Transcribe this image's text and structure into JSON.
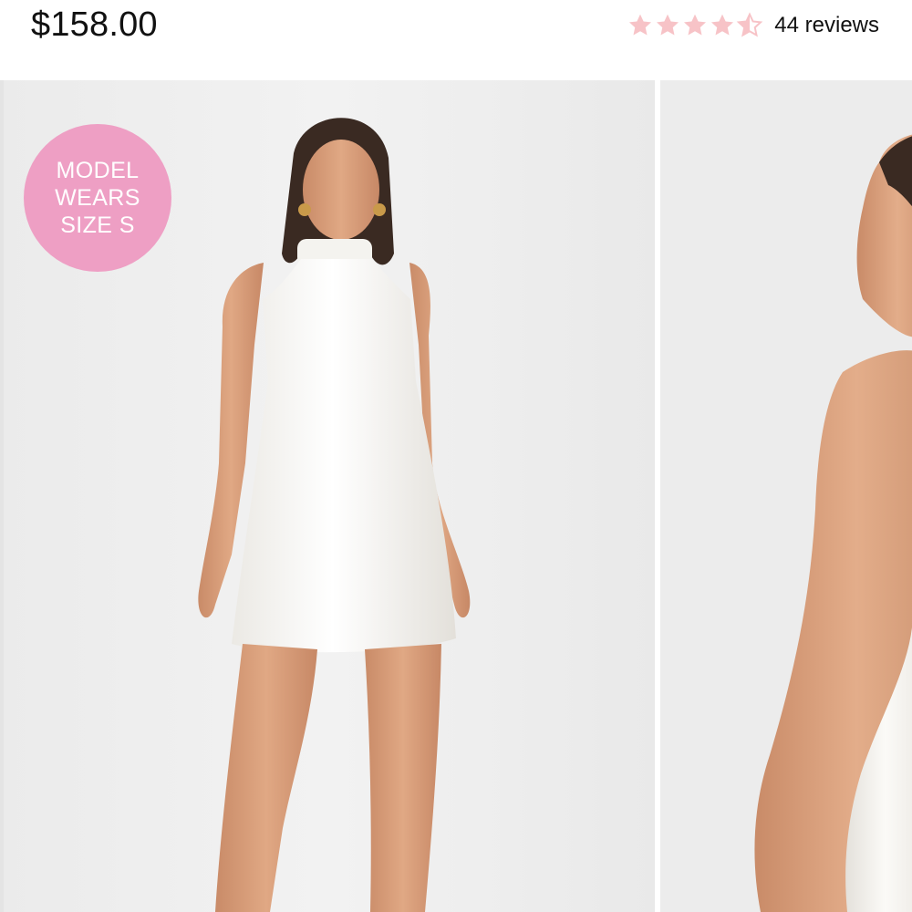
{
  "product": {
    "price": "$158.00",
    "rating": {
      "value": 4.5,
      "max": 5,
      "star_color": "#f7c3c7",
      "reviews_label": "44 reviews",
      "icon": "star-icon"
    }
  },
  "gallery": {
    "badge": {
      "lines": [
        "MODEL",
        "WEARS",
        "SIZE S"
      ],
      "color": "#ee9fc4"
    },
    "images": [
      {
        "name": "front-view",
        "label": "white satin halter mini dress - front"
      },
      {
        "name": "back-view",
        "label": "white satin halter mini dress - back"
      }
    ]
  }
}
